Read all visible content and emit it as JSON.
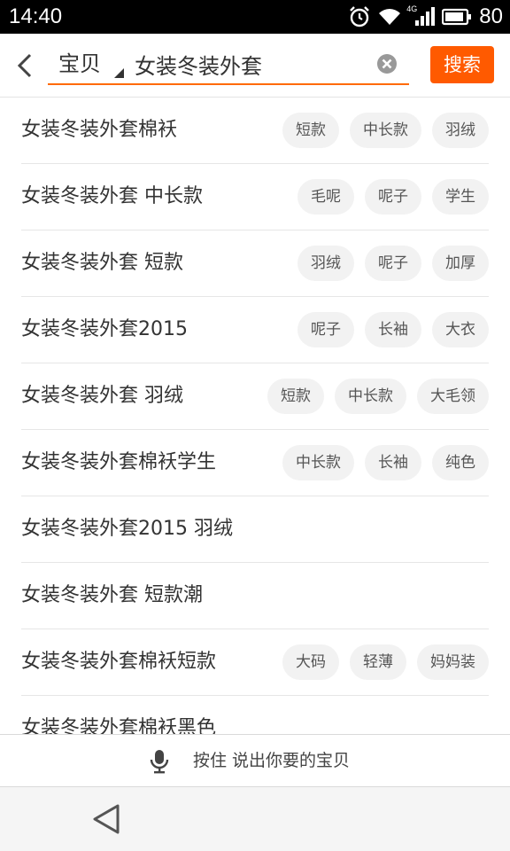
{
  "status_bar": {
    "time": "14:40",
    "network_label": "4G",
    "battery_level": "80",
    "icons": [
      "alarm-icon",
      "wifi-icon",
      "signal-icon",
      "battery-icon"
    ]
  },
  "search": {
    "scope": "宝贝",
    "query": "女装冬装外套",
    "search_button": "搜索"
  },
  "suggestions": [
    {
      "text": "女装冬装外套棉袄",
      "tags": [
        "短款",
        "中长款",
        "羽绒"
      ]
    },
    {
      "text": "女装冬装外套 中长款",
      "tags": [
        "毛呢",
        "呢子",
        "学生"
      ]
    },
    {
      "text": "女装冬装外套 短款",
      "tags": [
        "羽绒",
        "呢子",
        "加厚"
      ]
    },
    {
      "text": "女装冬装外套2015",
      "tags": [
        "呢子",
        "长袖",
        "大衣"
      ]
    },
    {
      "text": "女装冬装外套 羽绒",
      "tags": [
        "短款",
        "中长款",
        "大毛领"
      ]
    },
    {
      "text": "女装冬装外套棉袄学生",
      "tags": [
        "中长款",
        "长袖",
        "纯色"
      ]
    },
    {
      "text": "女装冬装外套2015 羽绒",
      "tags": []
    },
    {
      "text": "女装冬装外套 短款潮",
      "tags": []
    },
    {
      "text": "女装冬装外套棉袄短款",
      "tags": [
        "大码",
        "轻薄",
        "妈妈装"
      ]
    },
    {
      "text": "女装冬装外套棉袄黑色",
      "tags": []
    }
  ],
  "voice": {
    "prompt": "按住 说出你要的宝贝"
  },
  "colors": {
    "accent": "#ff5a00",
    "underline": "#ff6a00",
    "tag_bg": "#f2f2f2"
  }
}
